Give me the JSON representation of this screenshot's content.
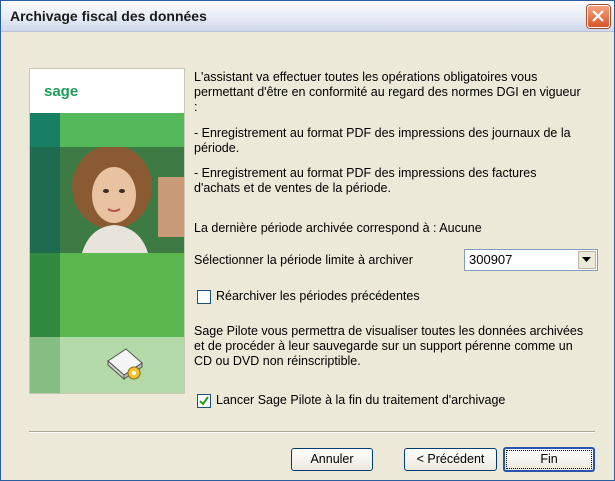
{
  "window": {
    "title": "Archivage fiscal des données",
    "close_glyph": "✕"
  },
  "side": {
    "logo": "sage"
  },
  "body": {
    "intro": "L'assistant va effectuer toutes les opérations obligatoires vous permettant d'être en conformité au regard des normes DGI en vigueur :",
    "bullet1": "- Enregistrement au format PDF des impressions des journaux de la période.",
    "bullet2": "- Enregistrement au format PDF des impressions des factures d'achats et de ventes de la période.",
    "last_period": "La dernière période archivée correspond à : Aucune",
    "select_label": "Sélectionner la période limite à archiver",
    "select_value": "300907",
    "rearchive_label": "Réarchiver les périodes précédentes",
    "rearchive_checked": false,
    "pilote_text": "Sage Pilote vous permettra de visualiser toutes les données archivées et de procéder à leur sauvegarde sur un support pérenne comme un CD ou DVD non réinscriptible.",
    "launch_label": "Lancer Sage Pilote à la fin du traitement d'archivage",
    "launch_checked": true
  },
  "buttons": {
    "cancel": "Annuler",
    "previous": "< Précédent",
    "finish": "Fin"
  },
  "colors": {
    "title_bar": "#e6ebf5",
    "accent_green": "#5ab84e",
    "close_red": "#d8542a"
  }
}
